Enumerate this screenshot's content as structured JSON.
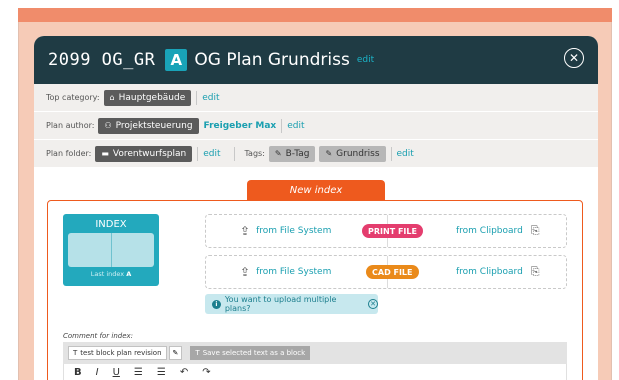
{
  "header": {
    "plan_code": "2099 OG_GR",
    "plan_letter": "A",
    "plan_name": "OG Plan Grundriss",
    "edit_label": "edit",
    "close_icon": "close-icon"
  },
  "meta": {
    "top_category_label": "Top category:",
    "top_category_value": "Hauptgebäude",
    "top_category_edit": "edit",
    "plan_author_label": "Plan author:",
    "plan_author_value": "Projektsteuerung",
    "plan_author_person": "Freigeber Max",
    "plan_author_edit": "edit",
    "plan_folder_label": "Plan folder:",
    "plan_folder_value": "Vorentwurfsplan",
    "plan_folder_edit": "edit",
    "tags_label": "Tags:",
    "tags": [
      "B-Tag",
      "Grundriss"
    ],
    "tags_edit": "edit"
  },
  "new_index": {
    "tab_label": "New index",
    "card_title": "INDEX",
    "last_index_label": "Last index",
    "last_index_value": "A",
    "print_row": {
      "from_file_system": "from File System",
      "pill": "PRINT FILE",
      "from_clipboard": "from Clipboard"
    },
    "cad_row": {
      "from_file_system": "from File System",
      "pill": "CAD FILE",
      "from_clipboard": "from Clipboard"
    },
    "multi_upload": "You want to upload multiple plans?",
    "comment_label": "Comment for index:",
    "block_button": "test block plan revision",
    "save_block_button": "Save selected text as a block",
    "format_buttons": [
      "B",
      "I",
      "U",
      "☰",
      "☰",
      "↶",
      "↷"
    ]
  },
  "colors": {
    "header_bg": "#1f3b44",
    "accent_teal": "#19a3b8",
    "accent_orange": "#ee5a1e",
    "print_pill": "#e43d6e",
    "cad_pill": "#ea8a1a"
  }
}
